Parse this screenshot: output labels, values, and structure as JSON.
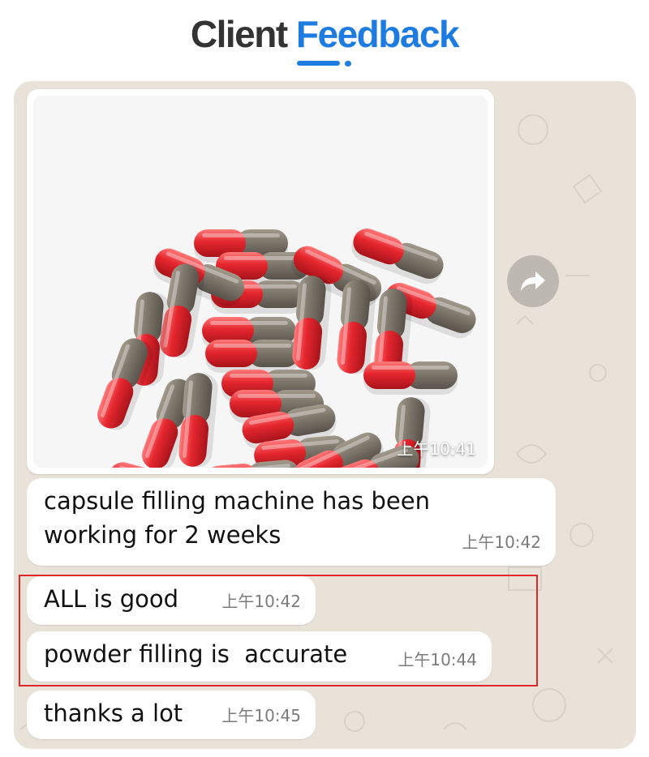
{
  "header": {
    "title_part1": "Client",
    "title_part2": "Feedback"
  },
  "colors": {
    "accent_blue": "#1e7be0",
    "chat_background": "#e9e2d8",
    "highlight_red": "#e02828",
    "bubble_white": "#ffffff"
  },
  "messages": [
    {
      "type": "image",
      "image_icon": "capsules-photo",
      "time": "上午10:41"
    },
    {
      "type": "text",
      "text": "capsule filling machine has been\nworking for 2 weeks",
      "time": "上午10:42"
    },
    {
      "type": "text",
      "text": "ALL is good",
      "time": "上午10:42"
    },
    {
      "type": "text",
      "text": "powder filling is  accurate",
      "time": "上午10:44"
    },
    {
      "type": "text",
      "text": "thanks a lot",
      "time": "上午10:45"
    }
  ],
  "icons": {
    "forward": "forward-arrow-icon"
  }
}
